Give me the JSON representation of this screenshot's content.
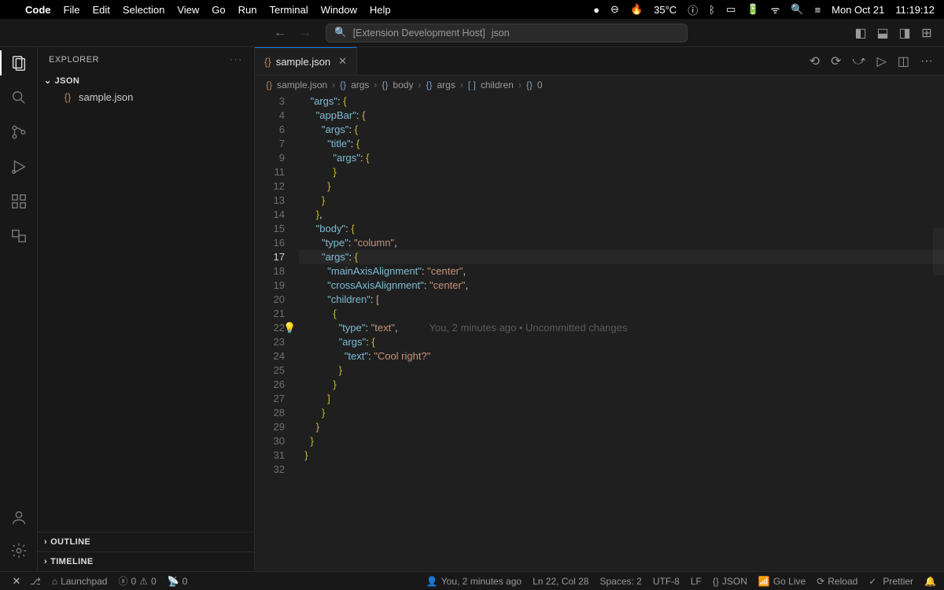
{
  "macMenu": {
    "app": "Code",
    "items": [
      "File",
      "Edit",
      "Selection",
      "View",
      "Go",
      "Run",
      "Terminal",
      "Window",
      "Help"
    ],
    "temp": "35°C",
    "date": "Mon Oct 21",
    "time": "11:19:12"
  },
  "titlebar": {
    "cmdPrefix": "[Extension Development Host]",
    "cmdTitle": "json"
  },
  "sidebar": {
    "title": "EXPLORER",
    "rootFolder": "JSON",
    "files": [
      {
        "name": "sample.json"
      }
    ],
    "outline": "OUTLINE",
    "timeline": "TIMELINE"
  },
  "tab": {
    "name": "sample.json"
  },
  "breadcrumb": [
    "sample.json",
    "args",
    "body",
    "args",
    "children",
    "0"
  ],
  "code": {
    "startLine": 3,
    "currentIndex": 11,
    "lines": [
      {
        "indent": 2,
        "tokens": [
          {
            "t": "\"args\"",
            "c": "k"
          },
          {
            "t": ": ",
            "c": "p"
          },
          {
            "t": "{",
            "c": "p2"
          }
        ]
      },
      {
        "indent": 3,
        "tokens": [
          {
            "t": "\"appBar\"",
            "c": "k"
          },
          {
            "t": ": ",
            "c": "p"
          },
          {
            "t": "{",
            "c": "p2"
          }
        ]
      },
      {
        "indent": 4,
        "tokens": [
          {
            "t": "\"args\"",
            "c": "k"
          },
          {
            "t": ": ",
            "c": "p"
          },
          {
            "t": "{",
            "c": "p2"
          }
        ]
      },
      {
        "indent": 5,
        "tokens": [
          {
            "t": "\"title\"",
            "c": "k"
          },
          {
            "t": ": ",
            "c": "p"
          },
          {
            "t": "{",
            "c": "p2"
          }
        ]
      },
      {
        "indent": 6,
        "tokens": [
          {
            "t": "\"args\"",
            "c": "k"
          },
          {
            "t": ": ",
            "c": "p"
          },
          {
            "t": "{",
            "c": "p2"
          }
        ]
      },
      {
        "indent": 6,
        "tokens": [
          {
            "t": "}",
            "c": "p2"
          }
        ]
      },
      {
        "indent": 5,
        "tokens": [
          {
            "t": "}",
            "c": "p2"
          }
        ]
      },
      {
        "indent": 4,
        "tokens": [
          {
            "t": "}",
            "c": "p2"
          }
        ]
      },
      {
        "indent": 3,
        "tokens": [
          {
            "t": "}",
            "c": "p2"
          },
          {
            "t": ",",
            "c": "p"
          }
        ]
      },
      {
        "indent": 3,
        "tokens": [
          {
            "t": "\"body\"",
            "c": "k"
          },
          {
            "t": ": ",
            "c": "p"
          },
          {
            "t": "{",
            "c": "p2"
          }
        ]
      },
      {
        "indent": 4,
        "tokens": [
          {
            "t": "\"type\"",
            "c": "k"
          },
          {
            "t": ": ",
            "c": "p"
          },
          {
            "t": "\"column\"",
            "c": "s"
          },
          {
            "t": ",",
            "c": "p"
          }
        ]
      },
      {
        "indent": 4,
        "tokens": [
          {
            "t": "\"args\"",
            "c": "k"
          },
          {
            "t": ": ",
            "c": "p"
          },
          {
            "t": "{",
            "c": "p2"
          }
        ]
      },
      {
        "indent": 5,
        "tokens": [
          {
            "t": "\"mainAxisAlignment\"",
            "c": "k"
          },
          {
            "t": ": ",
            "c": "p"
          },
          {
            "t": "\"center\"",
            "c": "s"
          },
          {
            "t": ",",
            "c": "p"
          }
        ]
      },
      {
        "indent": 5,
        "tokens": [
          {
            "t": "\"crossAxisAlignment\"",
            "c": "k"
          },
          {
            "t": ": ",
            "c": "p"
          },
          {
            "t": "\"center\"",
            "c": "s"
          },
          {
            "t": ",",
            "c": "p"
          }
        ]
      },
      {
        "indent": 5,
        "tokens": [
          {
            "t": "\"children\"",
            "c": "k"
          },
          {
            "t": ": ",
            "c": "p"
          },
          {
            "t": "[",
            "c": "p2"
          }
        ]
      },
      {
        "indent": 6,
        "tokens": [
          {
            "t": "{",
            "c": "p2"
          }
        ]
      },
      {
        "indent": 7,
        "bulb": true,
        "tokens": [
          {
            "t": "\"type\"",
            "c": "k"
          },
          {
            "t": ": ",
            "c": "p"
          },
          {
            "t": "\"text\"",
            "c": "s"
          },
          {
            "t": ",",
            "c": "p"
          }
        ],
        "blame": "You, 2 minutes ago • Uncommitted changes"
      },
      {
        "indent": 7,
        "tokens": [
          {
            "t": "\"args\"",
            "c": "k"
          },
          {
            "t": ": ",
            "c": "p"
          },
          {
            "t": "{",
            "c": "p2"
          }
        ]
      },
      {
        "indent": 8,
        "tokens": [
          {
            "t": "\"text\"",
            "c": "k"
          },
          {
            "t": ": ",
            "c": "p"
          },
          {
            "t": "\"Cool right?\"",
            "c": "s"
          }
        ]
      },
      {
        "indent": 7,
        "tokens": [
          {
            "t": "}",
            "c": "p2"
          }
        ]
      },
      {
        "indent": 6,
        "tokens": [
          {
            "t": "}",
            "c": "p2"
          }
        ]
      },
      {
        "indent": 5,
        "tokens": [
          {
            "t": "]",
            "c": "p2"
          }
        ]
      },
      {
        "indent": 4,
        "tokens": [
          {
            "t": "}",
            "c": "p2"
          }
        ]
      },
      {
        "indent": 3,
        "tokens": [
          {
            "t": "}",
            "c": "p2"
          }
        ]
      },
      {
        "indent": 2,
        "tokens": [
          {
            "t": "}",
            "c": "p2"
          }
        ]
      },
      {
        "indent": 1,
        "tokens": [
          {
            "t": "}",
            "c": "p2"
          }
        ]
      },
      {
        "indent": 0,
        "tokens": []
      }
    ],
    "lineNumbers": [
      "3",
      "4",
      "6",
      "7",
      "9",
      "11",
      "12",
      "13",
      "14",
      "15",
      "16",
      "17",
      "18",
      "19",
      "20",
      "21",
      "22",
      "23",
      "24",
      "25",
      "26",
      "27",
      "28",
      "29",
      "30",
      "31",
      "32"
    ]
  },
  "status": {
    "launchpad": "Launchpad",
    "errors": "0",
    "warnings": "0",
    "ports": "0",
    "blame": "You, 2 minutes ago",
    "lncol": "Ln 22, Col 28",
    "spaces": "Spaces: 2",
    "encoding": "UTF-8",
    "eol": "LF",
    "lang": "JSON",
    "golive": "Go Live",
    "reload": "Reload",
    "prettier": "Prettier"
  }
}
